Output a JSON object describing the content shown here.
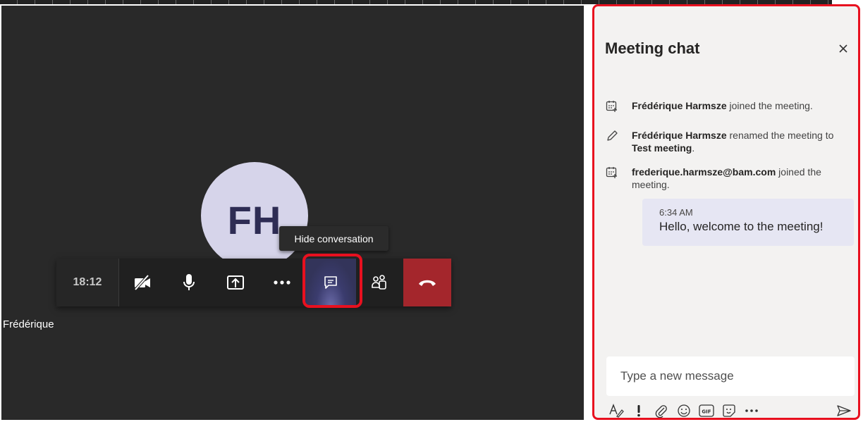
{
  "call": {
    "avatar_initials": "FH",
    "participant_name": "Frédérique",
    "timer": "18:12",
    "tooltip": "Hide conversation",
    "toolbar_icons": [
      "camera-off-icon",
      "microphone-icon",
      "share-screen-icon",
      "more-icon",
      "chat-icon",
      "participants-icon",
      "hang-up-icon"
    ]
  },
  "chat": {
    "title": "Meeting chat",
    "events": [
      {
        "icon": "calendar-add-icon",
        "name": "Frédérique Harmsze",
        "text": " joined the meeting."
      },
      {
        "icon": "pencil-icon",
        "name": "Frédérique Harmsze",
        "text": " renamed the meeting to ",
        "extra": "Test meeting",
        "suffix": "."
      },
      {
        "icon": "calendar-add-icon",
        "name": "frederique.harmsze@bam.com",
        "text": " joined the meeting."
      }
    ],
    "message": {
      "time": "6:34 AM",
      "text": "Hello, welcome to the meeting!"
    },
    "compose_placeholder": "Type a new message",
    "compose_icons": [
      "format-icon",
      "important-icon",
      "attach-icon",
      "emoji-icon",
      "gif-icon",
      "sticker-icon",
      "more-icon",
      "send-icon"
    ]
  },
  "colors": {
    "stage_bg": "#292929",
    "accent_purple": "#33345a",
    "hangup_red": "#a4262c",
    "highlight_red": "#e8101f"
  }
}
